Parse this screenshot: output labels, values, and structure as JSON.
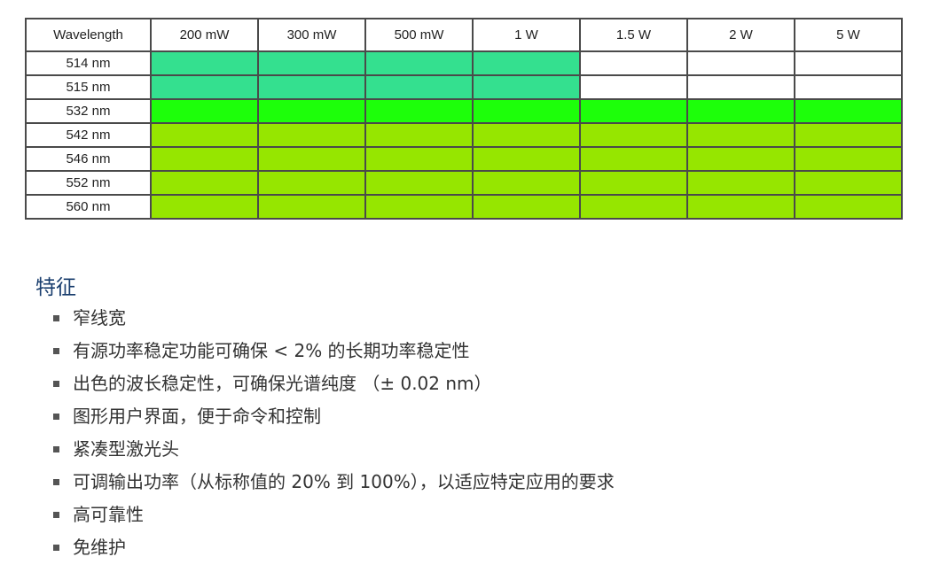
{
  "colors": {
    "available_514_515": "#34e08f",
    "available_532": "#1dff0a",
    "available_542_560": "#96e600",
    "unavailable": "#ffffff",
    "grid_border": "#4a4a4a",
    "features_title": "#1a3e6e"
  },
  "table": {
    "header": {
      "wavelength_label": "Wavelength",
      "powers": [
        "200 mW",
        "300 mW",
        "500 mW",
        "1 W",
        "1.5 W",
        "2 W",
        "5 W"
      ]
    },
    "rows": [
      {
        "wavelength": "514 nm",
        "availability": [
          1,
          1,
          1,
          1,
          0,
          0,
          0
        ],
        "color_key": "available_514_515"
      },
      {
        "wavelength": "515 nm",
        "availability": [
          1,
          1,
          1,
          1,
          0,
          0,
          0
        ],
        "color_key": "available_514_515"
      },
      {
        "wavelength": "532 nm",
        "availability": [
          1,
          1,
          1,
          1,
          1,
          1,
          1
        ],
        "color_key": "available_532"
      },
      {
        "wavelength": "542 nm",
        "availability": [
          1,
          1,
          1,
          1,
          1,
          1,
          1
        ],
        "color_key": "available_542_560"
      },
      {
        "wavelength": "546 nm",
        "availability": [
          1,
          1,
          1,
          1,
          1,
          1,
          1
        ],
        "color_key": "available_542_560"
      },
      {
        "wavelength": "552 nm",
        "availability": [
          1,
          1,
          1,
          1,
          1,
          1,
          1
        ],
        "color_key": "available_542_560"
      },
      {
        "wavelength": "560 nm",
        "availability": [
          1,
          1,
          1,
          1,
          1,
          1,
          1
        ],
        "color_key": "available_542_560"
      }
    ]
  },
  "features": {
    "title": "特征",
    "items": [
      "窄线宽",
      "有源功率稳定功能可确保 < 2% 的长期功率稳定性",
      "出色的波长稳定性，可确保光谱纯度 （± 0.02 nm）",
      "图形用户界面，便于命令和控制",
      "紧凑型激光头",
      "可调输出功率（从标称值的 20% 到 100%），以适应特定应用的要求",
      "高可靠性",
      "免维护"
    ]
  }
}
